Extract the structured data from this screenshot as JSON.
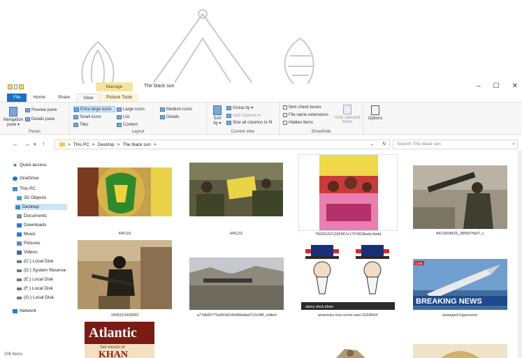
{
  "window": {
    "title": "The black sun",
    "manage_tab": "Manage",
    "minimize": "–",
    "maximize": "☐",
    "close": "✕"
  },
  "ribbon_tabs": [
    "File",
    "Home",
    "Share",
    "View",
    "Picture Tools"
  ],
  "ribbon": {
    "panes": {
      "label": "Panes",
      "navigation_pane": "Navigation pane ▾",
      "preview_pane": "Preview pane",
      "details_pane": "Details pane"
    },
    "layout": {
      "label": "Layout",
      "options": [
        "Extra large icons",
        "Large icons",
        "Medium icons",
        "Small icons",
        "List",
        "Details",
        "Tiles",
        "Content",
        ""
      ],
      "selected": "Extra large icons"
    },
    "current_view": {
      "label": "Current view",
      "sort_by": "Sort by ▾",
      "group_by": "Group by ▾",
      "add_columns": "Add columns ▾",
      "size_columns": "Size all columns to fit"
    },
    "show_hide": {
      "label": "Show/hide",
      "item_check_boxes": "Item check boxes",
      "file_name_extensions": "File name extensions",
      "hidden_items": "Hidden items",
      "hide_selected": "Hide selected items"
    },
    "options": "Options"
  },
  "address": {
    "back": "←",
    "forward": "→",
    "recent": "▾",
    "up": "↑",
    "path": [
      "This PC",
      "Desktop",
      "The black sun"
    ],
    "separator": ">",
    "dropdown": "⌄",
    "refresh": "↻",
    "search_placeholder": "Search The black sun"
  },
  "nav_pane": [
    {
      "label": "Quick access",
      "icon": "star-icon",
      "color": "#1e73c8"
    },
    {
      "label": "OneDrive",
      "icon": "cloud-icon",
      "color": "#1e73c8"
    },
    {
      "label": "This PC",
      "icon": "pc-icon",
      "color": "#3a8ed8"
    },
    {
      "label": "3D Objects",
      "icon": "cube-icon",
      "color": "#3aa0e0"
    },
    {
      "label": "Desktop",
      "icon": "desktop-icon",
      "color": "#3a8ed8"
    },
    {
      "label": "Documents",
      "icon": "document-icon",
      "color": "#8a8a8a"
    },
    {
      "label": "Downloads",
      "icon": "download-icon",
      "color": "#2a7bd0"
    },
    {
      "label": "Music",
      "icon": "music-icon",
      "color": "#2a7bd0"
    },
    {
      "label": "Pictures",
      "icon": "pictures-icon",
      "color": "#5a8abf"
    },
    {
      "label": "Videos",
      "icon": "video-icon",
      "color": "#4a6a8a"
    },
    {
      "label": "(C:) Local Disk",
      "icon": "drive-icon",
      "color": "#6a7a8a"
    },
    {
      "label": "(D:) System Reserve",
      "icon": "drive-icon",
      "color": "#6a7a8a"
    },
    {
      "label": "(E:) Local Disk",
      "icon": "drive-icon",
      "color": "#6a7a8a"
    },
    {
      "label": "(F:) Local Disk",
      "icon": "drive-icon",
      "color": "#6a7a8a"
    },
    {
      "label": "(G:) Local Disk",
      "icon": "drive-icon",
      "color": "#6a7a8a"
    },
    {
      "label": "Network",
      "icon": "network-icon",
      "color": "#2a7bd0"
    }
  ],
  "files": [
    {
      "name": "445119",
      "kind": "face-flag"
    },
    {
      "name": "445132",
      "kind": "soldiers-flag"
    },
    {
      "name": "756261521292967e1707823ba6c4a4d",
      "kind": "crowd"
    },
    {
      "name": "8413504829_38556?fa07_c",
      "kind": "rpg"
    },
    {
      "name": "1495313428992",
      "kind": "fighter"
    },
    {
      "name": "a77db90775a653d145d8bddad713c0f8_edited",
      "kind": "landscape"
    },
    {
      "name": "american-icon-uncle-sam-G2HBHX",
      "kind": "uncle-sam"
    },
    {
      "name": "avangard hypersonic",
      "kind": "missile"
    },
    {
      "name": "",
      "kind": "atlantic"
    },
    {
      "name": "",
      "kind": "partial-a"
    },
    {
      "name": "",
      "kind": "partial-b"
    }
  ],
  "thumb_text": {
    "breaking_news": "BREAKING NEWS",
    "live": "LIVE",
    "atlantic": "Atlantic",
    "atlantic_sub": "THE WRATH OF",
    "khan": "KHAN",
    "alamy": "alamy stock photo"
  },
  "status": {
    "count": "206 items"
  }
}
